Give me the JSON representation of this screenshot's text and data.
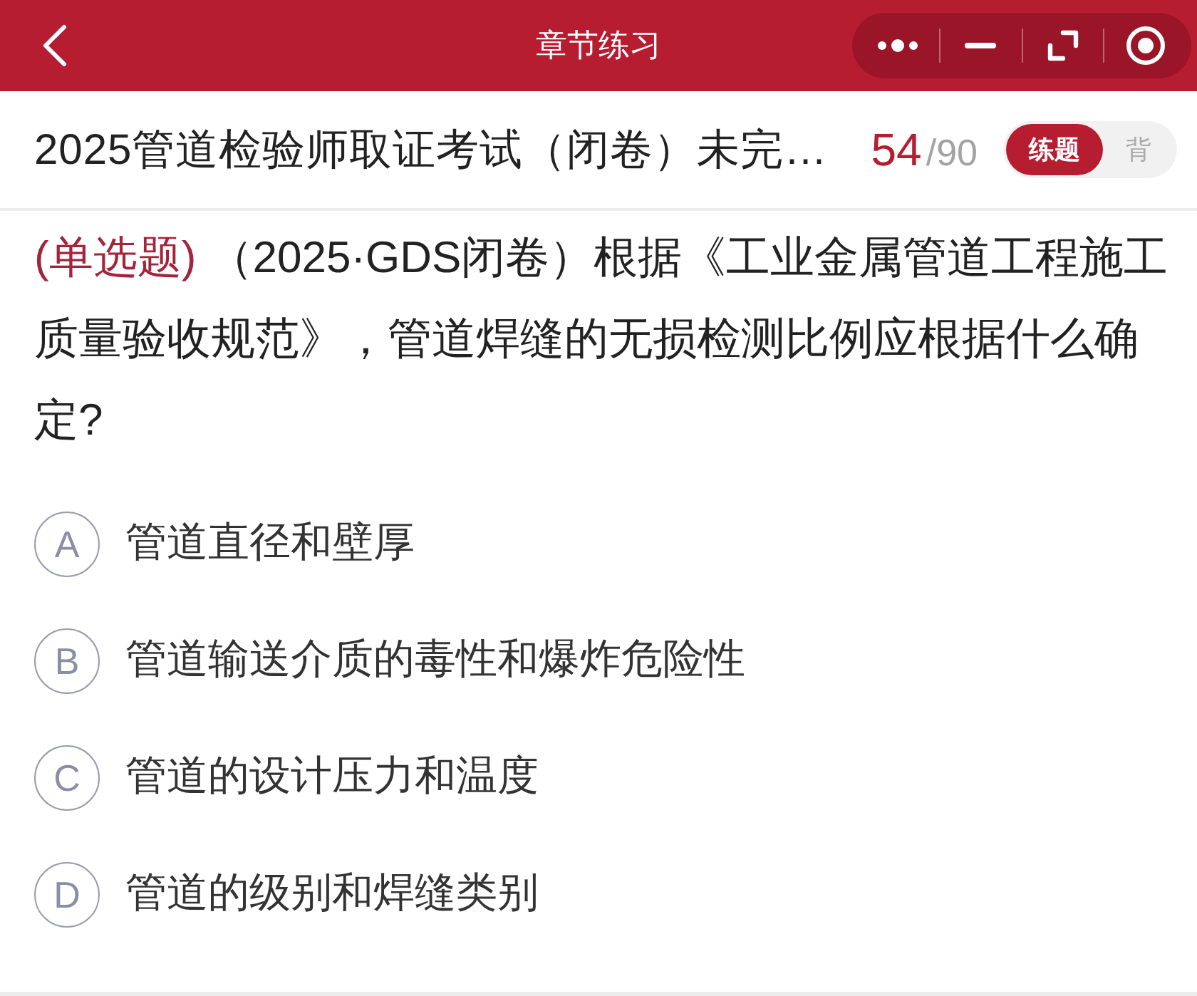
{
  "nav_bar": {
    "title": "章节练习"
  },
  "header": {
    "title": "2025管道检验师取证考试（闭卷）未完…",
    "current": "54",
    "total": "/90",
    "mode_toggle": [
      {
        "label": "练题",
        "selected": true
      },
      {
        "label": "背",
        "selected": false
      }
    ]
  },
  "question": {
    "type_label": "(单选题)",
    "text": " （2025·GDS闭卷）根据《工业金属管道工程施工质量验收规范》，管道焊缝的无损检测比例应根据什么确定?"
  },
  "options": [
    {
      "letter": "A",
      "text": "管道直径和壁厚",
      "selected": false
    },
    {
      "letter": "B",
      "text": "管道输送介质的毒性和爆炸危险性",
      "selected": false
    },
    {
      "letter": "C",
      "text": "管道的设计压力和温度",
      "selected": false
    },
    {
      "letter": "D",
      "text": "管道的级别和焊缝类别",
      "selected": false
    }
  ]
}
